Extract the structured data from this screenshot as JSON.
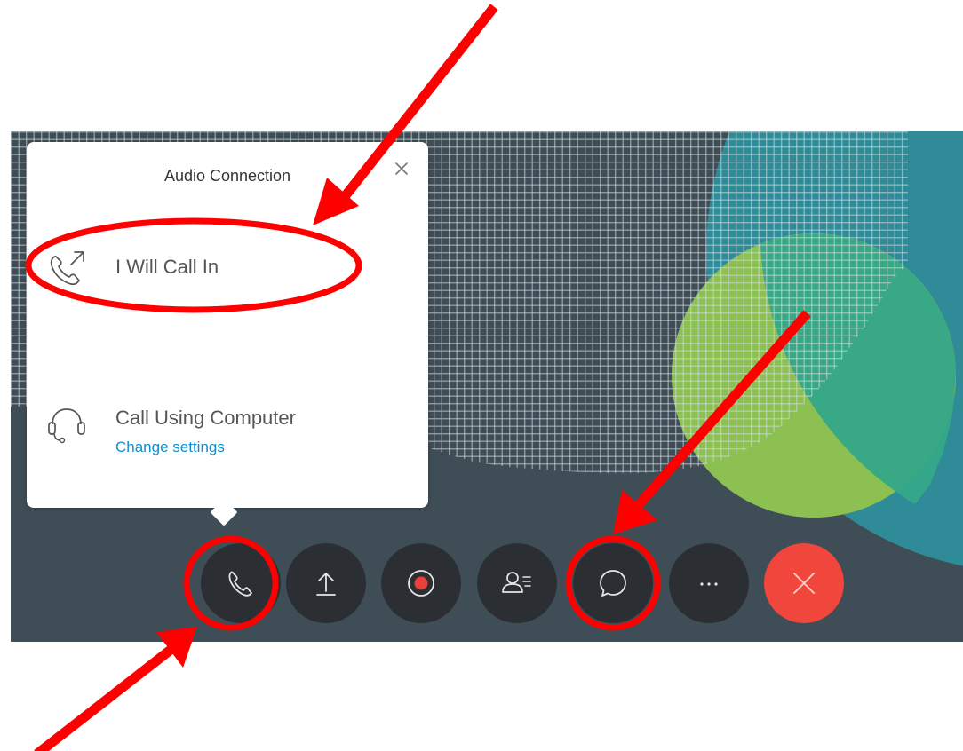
{
  "audio_popover": {
    "title": "Audio Connection",
    "close_icon": "close-icon",
    "options": [
      {
        "label": "I Will Call In",
        "icon": "phone-outgoing-icon"
      },
      {
        "label": "Call Using Computer",
        "icon": "headset-icon",
        "link": "Change settings"
      }
    ]
  },
  "control_bar": {
    "buttons": [
      {
        "name": "audio-button",
        "icon": "phone-icon"
      },
      {
        "name": "share-button",
        "icon": "upload-icon"
      },
      {
        "name": "record-button",
        "icon": "record-icon"
      },
      {
        "name": "participants-button",
        "icon": "participants-icon"
      },
      {
        "name": "chat-button",
        "icon": "chat-bubble-icon"
      },
      {
        "name": "more-button",
        "icon": "more-horizontal-icon"
      },
      {
        "name": "leave-button",
        "icon": "close-icon"
      }
    ]
  },
  "colors": {
    "stage_background": "#3f4d57",
    "popover_background": "#ffffff",
    "link": "#0f8fcd",
    "control_button": "#2b2f33",
    "leave_button": "#f0463c",
    "record_dot": "#e8403a",
    "annotation_red": "#ff0000",
    "graphic_green": "#8cc152",
    "graphic_teal": "#2e8b97"
  }
}
